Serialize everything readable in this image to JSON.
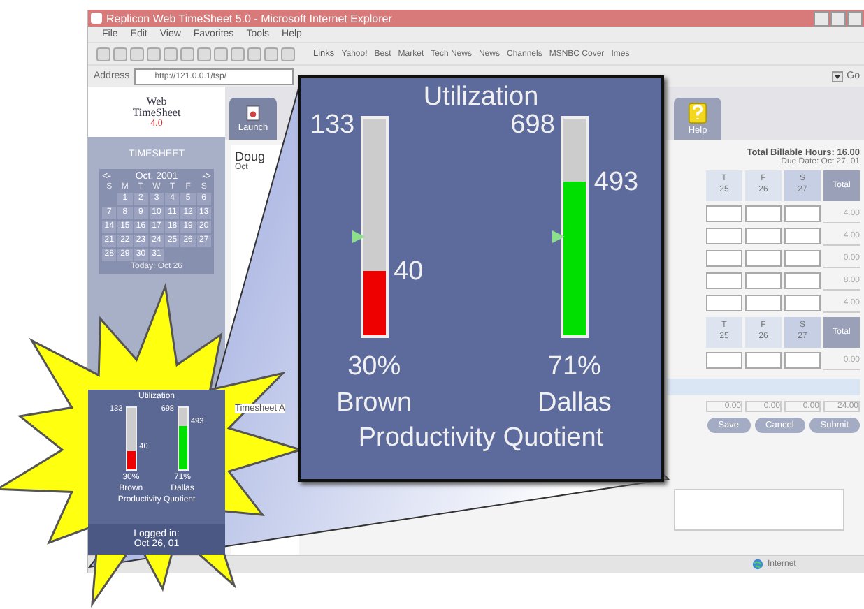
{
  "window": {
    "title": "Replicon Web TimeSheet 5.0 - Microsoft Internet Explorer"
  },
  "menu": [
    "File",
    "Edit",
    "View",
    "Favorites",
    "Tools",
    "Help"
  ],
  "links_bar": {
    "label": "Links",
    "items": [
      "Yahoo!",
      "Best",
      "Market",
      "Tech News",
      "News",
      "Channels",
      "MSNBC Cover",
      "Imes"
    ]
  },
  "address_bar": {
    "label": "Address",
    "value": "http://121.0.0.1/tsp/",
    "go": "Go"
  },
  "sidebar": {
    "logo": {
      "line1": "Web",
      "line2": "TimeSheet",
      "version": "4.0"
    },
    "heading": "TIMESHEET",
    "calendar": {
      "prev": "<-",
      "month": "Oct. 2001",
      "next": "->",
      "weekdays": [
        "S",
        "M",
        "T",
        "W",
        "T",
        "F",
        "S"
      ],
      "weeks": [
        [
          "1",
          "2",
          "3",
          "4",
          "5",
          "6"
        ],
        [
          "7",
          "8",
          "9",
          "10",
          "11",
          "12",
          "13"
        ],
        [
          "14",
          "15",
          "16",
          "17",
          "18",
          "19",
          "20"
        ],
        [
          "21",
          "22",
          "23",
          "24",
          "25",
          "26",
          "27"
        ],
        [
          "28",
          "29",
          "30",
          "31"
        ]
      ],
      "today": "Today: Oct 26"
    }
  },
  "tabs": [
    {
      "label": "Launch",
      "selected": true
    },
    {
      "label": "Help",
      "selected": false
    }
  ],
  "timesheet": {
    "employee": "Doug",
    "period": "Oct",
    "section": "Timesheet A",
    "total_billable": "Total Billable Hours: 16.00",
    "due_date": "Due Date: Oct 27, 01",
    "columns": [
      {
        "day": "T",
        "date": "25",
        "weekend": false
      },
      {
        "day": "F",
        "date": "26",
        "weekend": false
      },
      {
        "day": "S",
        "date": "27",
        "weekend": true
      }
    ],
    "total_label": "Total",
    "second_columns": [
      {
        "day": "T",
        "date": "25",
        "weekend": false
      },
      {
        "day": "F",
        "date": "26",
        "weekend": false
      },
      {
        "day": "S",
        "date": "27",
        "weekend": true
      }
    ],
    "second_total_label": "Total",
    "rows": [
      "4.00",
      "4.00",
      "0.00",
      "8.00",
      "4.00"
    ],
    "second_rows": [
      "0.00"
    ],
    "totals": [
      "0.00",
      "0.00",
      "0.00",
      "24.00"
    ],
    "buttons": [
      "Save",
      "Cancel",
      "Submit"
    ]
  },
  "mini_utilization": {
    "title": "Utilization",
    "gauges": [
      {
        "name": "Brown",
        "max": "133",
        "value": "40",
        "percent": "30%",
        "level": 0.3,
        "color": "#ee0000"
      },
      {
        "name": "Dallas",
        "max": "698",
        "value": "493",
        "percent": "71%",
        "level": 0.71,
        "color": "#00e000"
      }
    ],
    "caption": "Productivity Quotient"
  },
  "login": {
    "line1": "Logged in:",
    "line2": "Oct 26, 01"
  },
  "utilization": {
    "title": "Utilization",
    "gauges": [
      {
        "name": "Brown",
        "max": "133",
        "value": "40",
        "percent": "30%",
        "level": 0.3,
        "color": "#ee0000"
      },
      {
        "name": "Dallas",
        "max": "698",
        "value": "493",
        "percent": "71%",
        "level": 0.71,
        "color": "#00e000"
      }
    ],
    "caption": "Productivity Quotient"
  },
  "status_bar": {
    "zone": "Internet"
  }
}
